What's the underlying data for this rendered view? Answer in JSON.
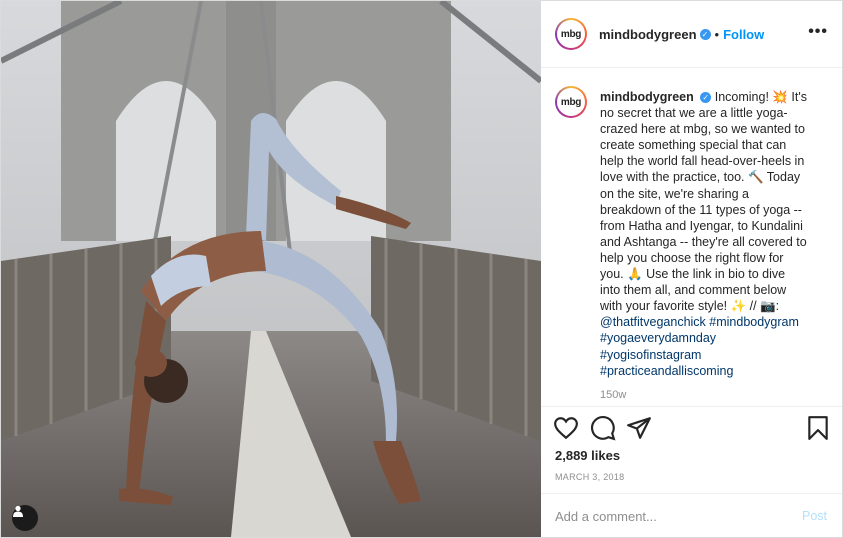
{
  "post": {
    "username": "mindbodygreen",
    "avatar_text": "mbg",
    "verified_glyph": "✓",
    "separator": "•",
    "follow_label": "Follow",
    "more_label": "•••",
    "caption_lines": [
      "Incoming! 💥 It's",
      "no secret that we are a little yoga-",
      "crazed here at mbg, so we wanted to",
      "create something special that can",
      "help the world fall head-over-heels in",
      "love with the practice, too. 🔨 Today",
      "on the site, we're sharing a",
      "breakdown of the 11 types of yoga --",
      "from Hatha and Iyengar, to Kundalini",
      "and Ashtanga -- they're all covered to",
      "help you choose the right flow for",
      "you. 🙏 Use the link in bio to dive",
      "into them all, and comment below",
      "with your favorite style! ✨ // 📷:"
    ],
    "tags": [
      "@thatfitveganchick #mindbodygram",
      "#yogaeverydamnday",
      "#yogisofinstagram",
      "#practiceandalliscoming"
    ],
    "time_ago": "150w",
    "likes": "2,889 likes",
    "date": "MARCH 3, 2018",
    "comment": {
      "placeholder": "Add a comment...",
      "value": "",
      "post_label": "Post"
    },
    "icons": {
      "like": "heart-icon",
      "comment": "speech-bubble-icon",
      "share": "paper-plane-icon",
      "save": "bookmark-icon",
      "more": "more-options-icon",
      "user_tag": "user-tag-icon"
    },
    "colors": {
      "accent": "#0095f6",
      "verified": "#3897f0",
      "tag_link": "#00376b",
      "muted": "#8e8e8e",
      "post_disabled": "#b2dffc"
    }
  }
}
